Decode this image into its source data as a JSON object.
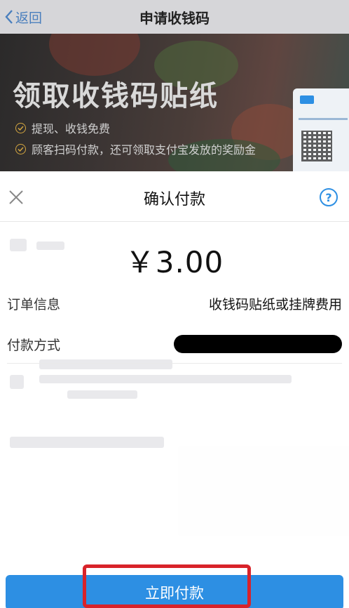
{
  "nav": {
    "back_label": "返回",
    "title": "申请收钱码"
  },
  "banner": {
    "title": "领取收钱码贴纸",
    "line1": "提现、收钱免费",
    "line2": "顾客扫码付款，还可领取支付宝发放的奖励金"
  },
  "sheet": {
    "title": "确认付款",
    "help_symbol": "?",
    "amount": "￥3.00",
    "order_label": "订单信息",
    "order_value": "收钱码贴纸或挂牌费用",
    "method_label": "付款方式",
    "pay_button_label": "立即付款"
  },
  "colors": {
    "accent": "#2d8fe3",
    "highlight": "#d8232a",
    "redaction": "#000000"
  },
  "icons": {
    "back": "chevron-left-icon",
    "close": "close-icon",
    "help": "help-icon",
    "check": "check-circle-icon"
  }
}
